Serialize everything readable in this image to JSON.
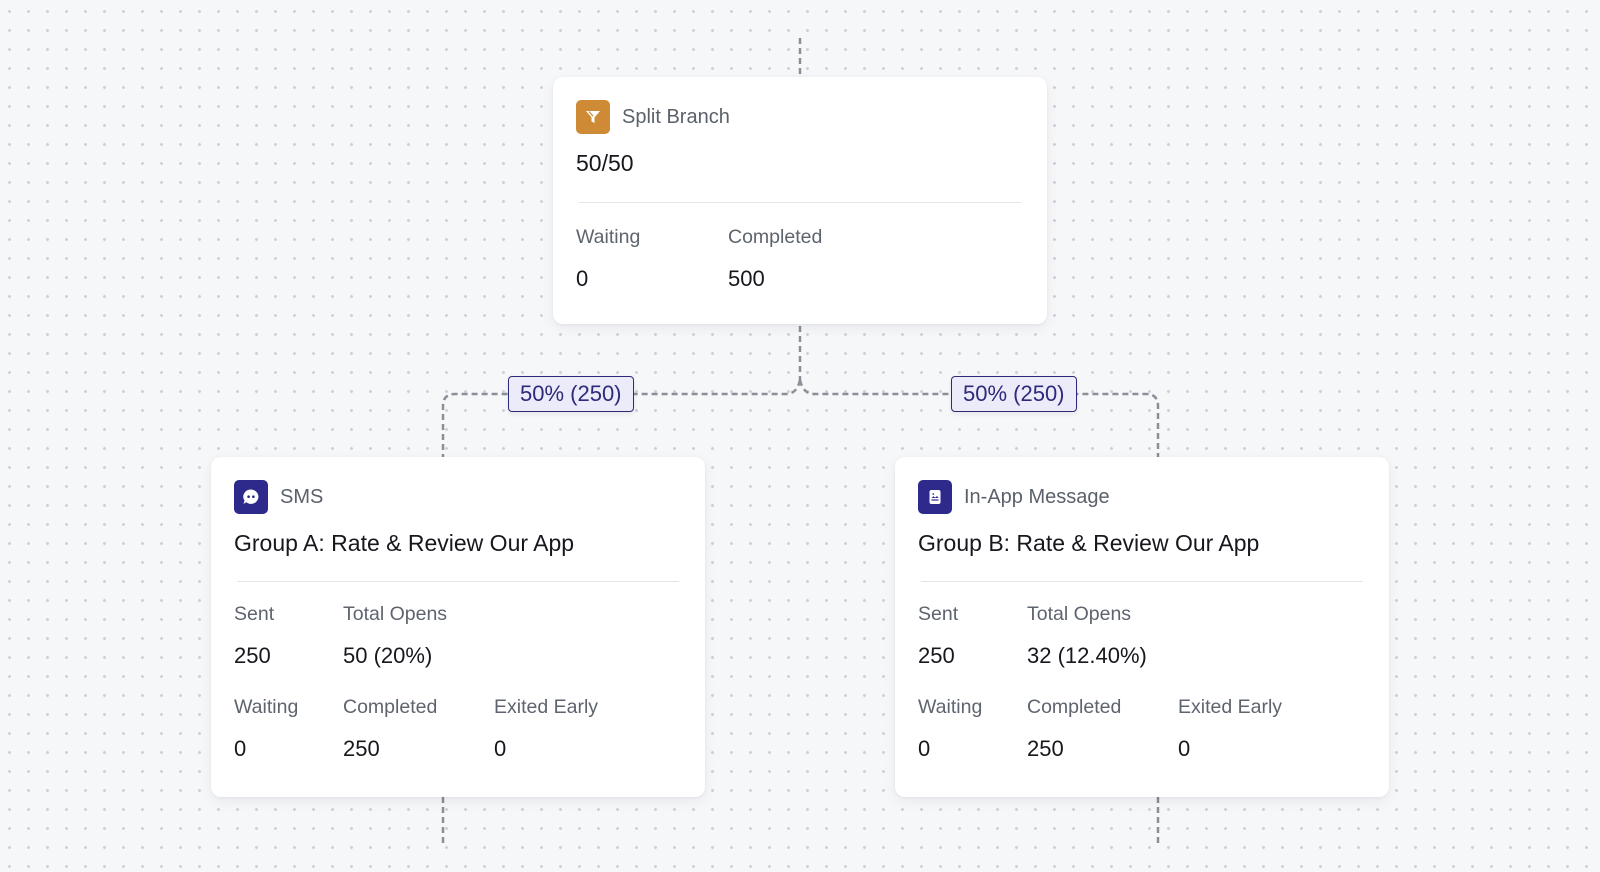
{
  "canvas": {
    "background_color": "#f6f7f9",
    "edge_color": "#8a8f98"
  },
  "nodes": {
    "split": {
      "type_label": "Split Branch",
      "icon": "filter-funnel-icon",
      "icon_color": "#cf8a35",
      "title": "50/50",
      "stats": [
        {
          "label": "Waiting",
          "value": "0"
        },
        {
          "label": "Completed",
          "value": "500"
        }
      ]
    },
    "sms": {
      "type_label": "SMS",
      "icon": "chat-bubble-icon",
      "icon_color": "#2e2a8c",
      "title": "Group A: Rate & Review Our App",
      "stats": [
        {
          "label": "Sent",
          "value": "250"
        },
        {
          "label": "Total Opens",
          "value": "50 (20%)"
        },
        {
          "label": "Waiting",
          "value": "0"
        },
        {
          "label": "Completed",
          "value": "250"
        },
        {
          "label": "Exited Early",
          "value": "0"
        }
      ]
    },
    "inapp": {
      "type_label": "In-App Message",
      "icon": "in-app-message-icon",
      "icon_color": "#2e2a8c",
      "title": "Group B: Rate & Review Our App",
      "stats": [
        {
          "label": "Sent",
          "value": "250"
        },
        {
          "label": "Total Opens",
          "value": "32 (12.40%)"
        },
        {
          "label": "Waiting",
          "value": "0"
        },
        {
          "label": "Completed",
          "value": "250"
        },
        {
          "label": "Exited Early",
          "value": "0"
        }
      ]
    }
  },
  "edges": {
    "left_label": "50% (250)",
    "right_label": "50% (250)",
    "label_color": "#2e2a7a",
    "label_bg": "#ecebfa"
  }
}
